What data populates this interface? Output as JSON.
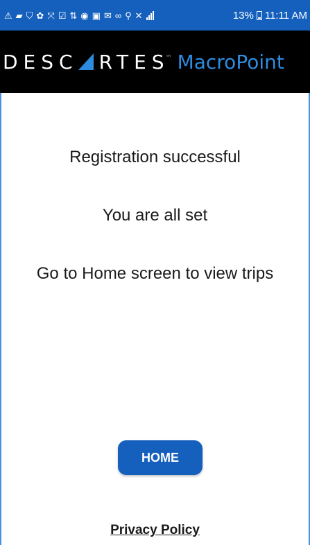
{
  "status_bar": {
    "icons": [
      "warning-icon",
      "chat-icon",
      "shield-wifi-icon",
      "flower-icon",
      "transfer-icon",
      "checkbox-icon",
      "swap-icon",
      "app-icon",
      "image-icon",
      "mail-icon",
      "voicemail-icon",
      "location-icon",
      "mute-icon",
      "signal-icon"
    ],
    "battery_percent": "13%",
    "time": "11:11 AM",
    "background_color": "#1560bd"
  },
  "header": {
    "brand_left": "DESC",
    "brand_right": "RTES",
    "trademark": "™",
    "product": "MacroPoint",
    "brand_color": "#ffffff",
    "accent_color": "#2d8ce0"
  },
  "main": {
    "message_1": "Registration successful",
    "message_2": "You are all set",
    "message_3": "Go to Home screen to view trips",
    "home_button": "HOME",
    "privacy_link": "Privacy Policy",
    "button_color": "#1560bd"
  }
}
